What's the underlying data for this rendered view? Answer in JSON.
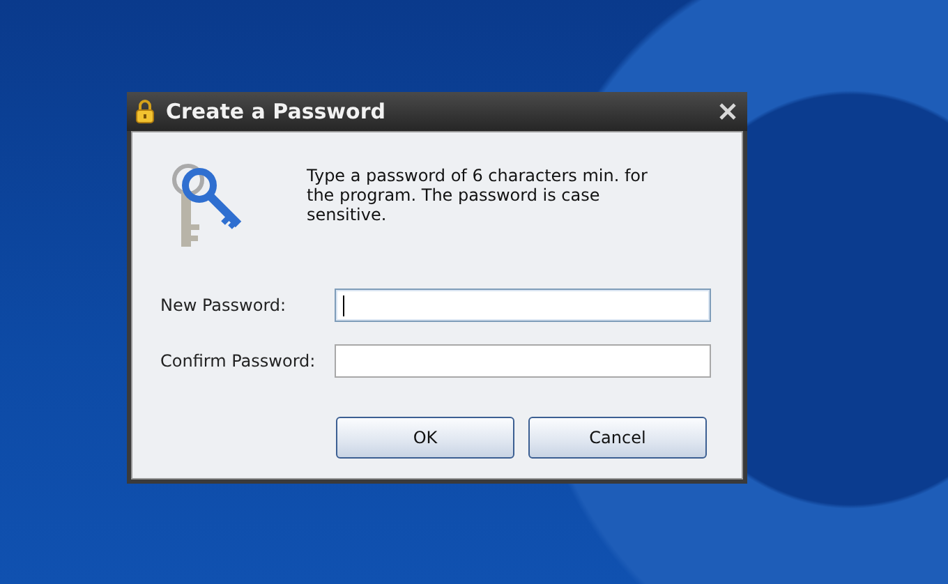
{
  "window": {
    "title": "Create a Password"
  },
  "message": "Type a password of 6 characters min. for the program. The password is case sensitive.",
  "fields": [
    {
      "label": "New Password:",
      "focused": true
    },
    {
      "label": "Confirm Password:",
      "focused": false
    }
  ],
  "buttons": [
    "OK",
    "Cancel"
  ]
}
